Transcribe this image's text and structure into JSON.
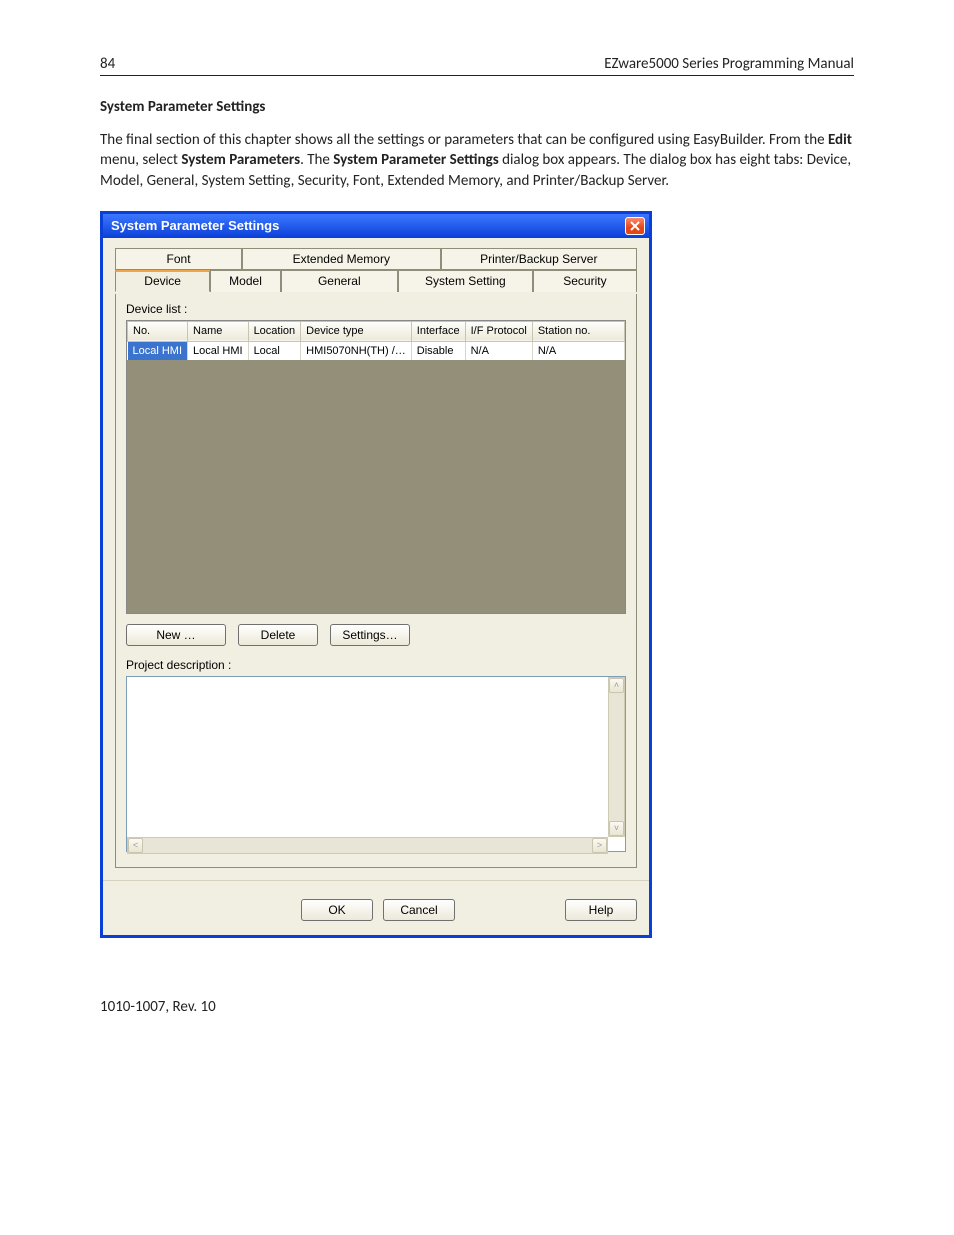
{
  "page": {
    "number": "84",
    "header_right": "EZware5000 Series Programming Manual",
    "footer": "1010-1007, Rev. 10"
  },
  "section": {
    "title": "System Parameter Settings",
    "para_1a": "The final section of this chapter shows all the settings or parameters that can be configured using EasyBuilder. From the ",
    "para_1b": "Edit",
    "para_1c": " menu, select ",
    "para_1d": "System Parameters",
    "para_1e": ". The ",
    "para_1f": "System Parameter Settings",
    "para_1g": " dialog box appears. The dialog box has eight tabs: Device, Model, General, System Setting, Security, Font, Extended Memory, and Printer/Backup Server."
  },
  "dialog": {
    "title": "System Parameter Settings",
    "tabs_upper": [
      "Font",
      "Extended Memory",
      "Printer/Backup Server"
    ],
    "tabs_lower": [
      "Device",
      "Model",
      "General",
      "System Setting",
      "Security"
    ],
    "active_tab": "Device",
    "device_list_label": "Device list :",
    "columns": [
      "No.",
      "Name",
      "Location",
      "Device type",
      "Interface",
      "I/F Protocol",
      "Station no."
    ],
    "rows": [
      {
        "no": "Local HMI",
        "name": "Local HMI",
        "location": "Local",
        "device_type": "HMI5070NH(TH) /…",
        "interface": "Disable",
        "if_protocol": "N/A",
        "station_no": "N/A"
      }
    ],
    "buttons": {
      "new": "New …",
      "delete": "Delete",
      "settings": "Settings…"
    },
    "project_description_label": "Project description :",
    "project_description_value": "",
    "footer_buttons": {
      "ok": "OK",
      "cancel": "Cancel",
      "help": "Help"
    }
  }
}
